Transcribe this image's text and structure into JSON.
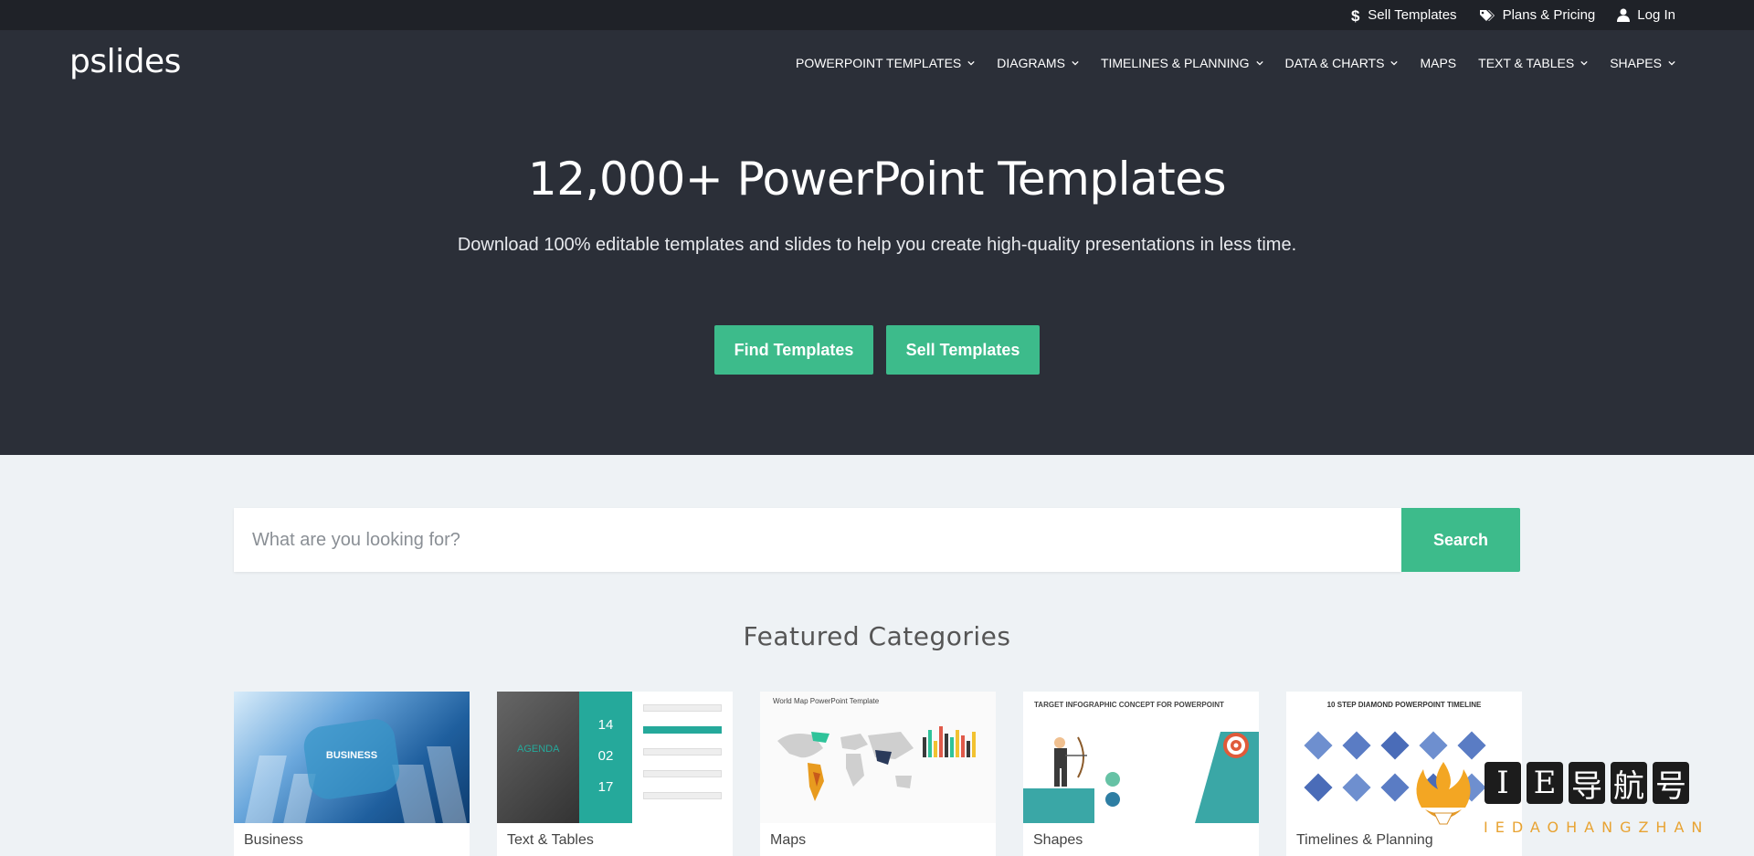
{
  "topbar": {
    "links": [
      {
        "label": "Sell Templates",
        "icon": "dollar-icon"
      },
      {
        "label": "Plans & Pricing",
        "icon": "tags-icon"
      },
      {
        "label": "Log In",
        "icon": "user-icon"
      }
    ]
  },
  "header": {
    "logo": "pslides",
    "nav": [
      {
        "label": "POWERPOINT TEMPLATES",
        "dropdown": true
      },
      {
        "label": "DIAGRAMS",
        "dropdown": true
      },
      {
        "label": "TIMELINES & PLANNING",
        "dropdown": true
      },
      {
        "label": "DATA & CHARTS",
        "dropdown": true
      },
      {
        "label": "MAPS",
        "dropdown": false
      },
      {
        "label": "TEXT & TABLES",
        "dropdown": true
      },
      {
        "label": "SHAPES",
        "dropdown": true
      }
    ]
  },
  "hero": {
    "title": "12,000+ PowerPoint Templates",
    "subtitle": "Download 100% editable templates and slides to help you create high-quality presentations in less time.",
    "find_button": "Find Templates",
    "sell_button": "Sell Templates"
  },
  "search": {
    "placeholder": "What are you looking for?",
    "value": "",
    "button": "Search"
  },
  "featured": {
    "title": "Featured Categories",
    "categories": [
      {
        "label": "Business",
        "thumb_text": "BUSINESS"
      },
      {
        "label": "Text & Tables",
        "thumb_text": "AGENDA",
        "thumb_numbers": [
          "14",
          "02",
          "17"
        ]
      },
      {
        "label": "Maps",
        "thumb_text": "World Map PowerPoint Template"
      },
      {
        "label": "Shapes",
        "thumb_text": "TARGET INFOGRAPHIC CONCEPT FOR POWERPOINT"
      },
      {
        "label": "Timelines & Planning",
        "thumb_text": "10 STEP DIAMOND POWERPOINT TIMELINE"
      }
    ]
  },
  "watermark": {
    "chars": [
      "I",
      "E",
      "导",
      "航",
      "号"
    ],
    "sub": "IEDAOHANGZHAN"
  },
  "colors": {
    "topbar_bg": "#1f2228",
    "hero_bg": "#2b2f38",
    "accent": "#3dbb8b",
    "page_bg": "#eef2f5"
  }
}
